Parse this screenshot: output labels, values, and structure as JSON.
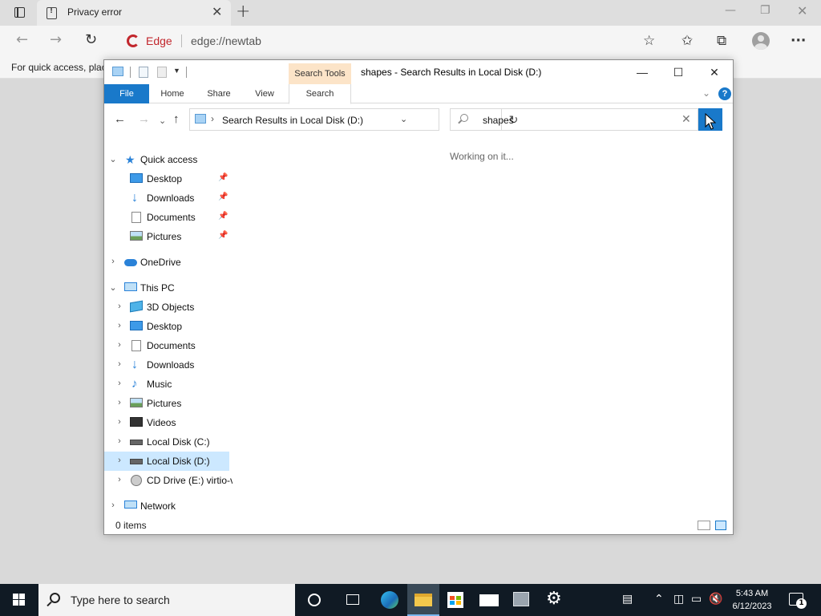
{
  "browser": {
    "tab_title": "Privacy error",
    "tab_close": "✕",
    "new_tab": "+",
    "window_controls": {
      "minimize": "—",
      "restore": "❐",
      "close": "✕"
    },
    "nav": {
      "back": "←",
      "forward": "→",
      "refresh": "↻"
    },
    "edge_label": "Edge",
    "url": "edge://newtab",
    "toolbar_icons": {
      "add_favorite": "☆",
      "favorites": "✩",
      "collections": "⧉",
      "menu": "···"
    },
    "favorites_bar_text": "For quick access, plac"
  },
  "explorer": {
    "title": "shapes - Search Results in Local Disk (D:)",
    "contextual_tab_group": "Search Tools",
    "ribbon_tabs": [
      "File",
      "Home",
      "Share",
      "View",
      "Search"
    ],
    "help": "?",
    "window_controls": {
      "minimize": "—",
      "maximize": "☐",
      "close": "✕"
    },
    "nav_buttons": {
      "back": "←",
      "forward": "→",
      "recent": "⌄",
      "up": "↑"
    },
    "address": {
      "chevron": "›",
      "text": "Search Results in Local Disk (D:)",
      "dropdown": "⌄",
      "refresh": "↻"
    },
    "search": {
      "value": "shapes",
      "clear": "✕",
      "go": "→"
    },
    "tree": {
      "quick_access": {
        "label": "Quick access",
        "chevron": "⌄",
        "items": [
          {
            "label": "Desktop",
            "pin": "📌"
          },
          {
            "label": "Downloads",
            "pin": "📌"
          },
          {
            "label": "Documents",
            "pin": "📌"
          },
          {
            "label": "Pictures",
            "pin": "📌"
          }
        ]
      },
      "onedrive": {
        "label": "OneDrive",
        "chevron": "›"
      },
      "this_pc": {
        "label": "This PC",
        "chevron": "⌄",
        "items": [
          {
            "label": "3D Objects",
            "chevron": "›"
          },
          {
            "label": "Desktop",
            "chevron": "›"
          },
          {
            "label": "Documents",
            "chevron": "›"
          },
          {
            "label": "Downloads",
            "chevron": "›"
          },
          {
            "label": "Music",
            "chevron": "›"
          },
          {
            "label": "Pictures",
            "chevron": "›"
          },
          {
            "label": "Videos",
            "chevron": "›"
          },
          {
            "label": "Local Disk (C:)",
            "chevron": "›"
          },
          {
            "label": "Local Disk (D:)",
            "chevron": "›"
          },
          {
            "label": "CD Drive (E:) virtio-v",
            "chevron": "›"
          }
        ]
      },
      "network": {
        "label": "Network",
        "chevron": "›"
      }
    },
    "content_status": "Working on it...",
    "status_bar": {
      "item_count": "0 items"
    }
  },
  "taskbar": {
    "search_placeholder": "Type here to search",
    "clock_time": "5:43 AM",
    "clock_date": "6/12/2023",
    "notification_count": "1"
  },
  "colors": {
    "accent": "#1979ca",
    "selection": "#cce8ff",
    "search_tools_header": "#fce4c8",
    "taskbar": "#101a24"
  }
}
